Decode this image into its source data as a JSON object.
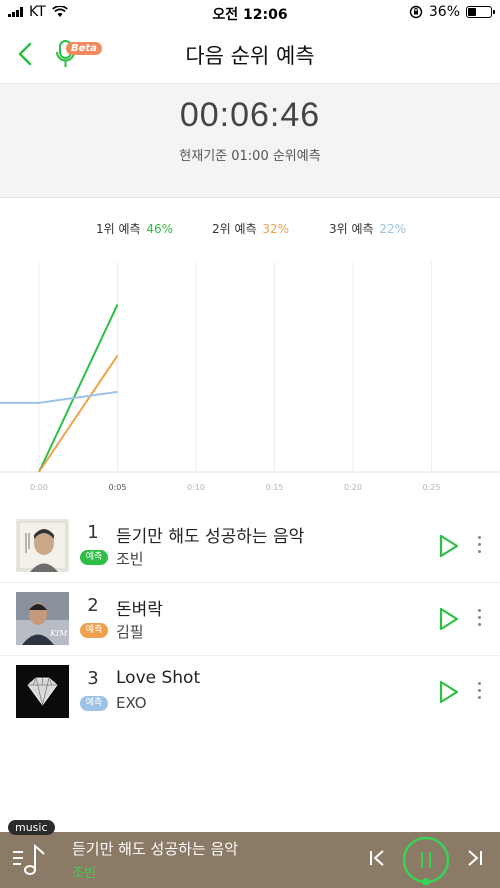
{
  "status_bar": {
    "carrier": "KT",
    "time": "오전 12:06",
    "battery": "36%",
    "battery_level": 0.36
  },
  "header": {
    "title": "다음 순위 예측",
    "beta": "Beta"
  },
  "timer": {
    "value": "00:06:46",
    "subtitle": "현재기준 01:00 순위예측"
  },
  "legend": [
    {
      "label": "1위 예측",
      "pct": "46%",
      "color": "#2bbf44"
    },
    {
      "label": "2위 예측",
      "pct": "32%",
      "color": "#f0a04b"
    },
    {
      "label": "3위 예측",
      "pct": "22%",
      "color": "#9cc3e5"
    }
  ],
  "chart_data": {
    "type": "line",
    "x": [
      "0:00",
      "0:05",
      "0:10",
      "0:15",
      "0:20",
      "0:25"
    ],
    "series": [
      {
        "name": "1위 예측",
        "values": [
          0,
          46
        ],
        "color": "#2bbf44"
      },
      {
        "name": "2위 예측",
        "values": [
          0,
          32
        ],
        "color": "#f0a04b"
      },
      {
        "name": "3위 예측",
        "values": [
          19,
          22
        ],
        "color": "#9cc3e5",
        "lead_in": 19
      }
    ],
    "highlight_x": "0:05",
    "ylim": [
      0,
      50
    ]
  },
  "songs": [
    {
      "rank": "1",
      "title": "듣기만 해도 성공하는 음악",
      "artist": "조빈",
      "badge": "예측",
      "badge_color": "#2bbf44"
    },
    {
      "rank": "2",
      "title": "돈벼락",
      "artist": "김필",
      "badge": "예측",
      "badge_color": "#f0a04b"
    },
    {
      "rank": "3",
      "title": "Love Shot",
      "artist": "EXO",
      "badge": "예측",
      "badge_color": "#9cc3e5"
    }
  ],
  "player": {
    "tag": "music",
    "title": "듣기만 해도 성공하는 음악",
    "artist": "조빈",
    "accent": "#39d353"
  }
}
